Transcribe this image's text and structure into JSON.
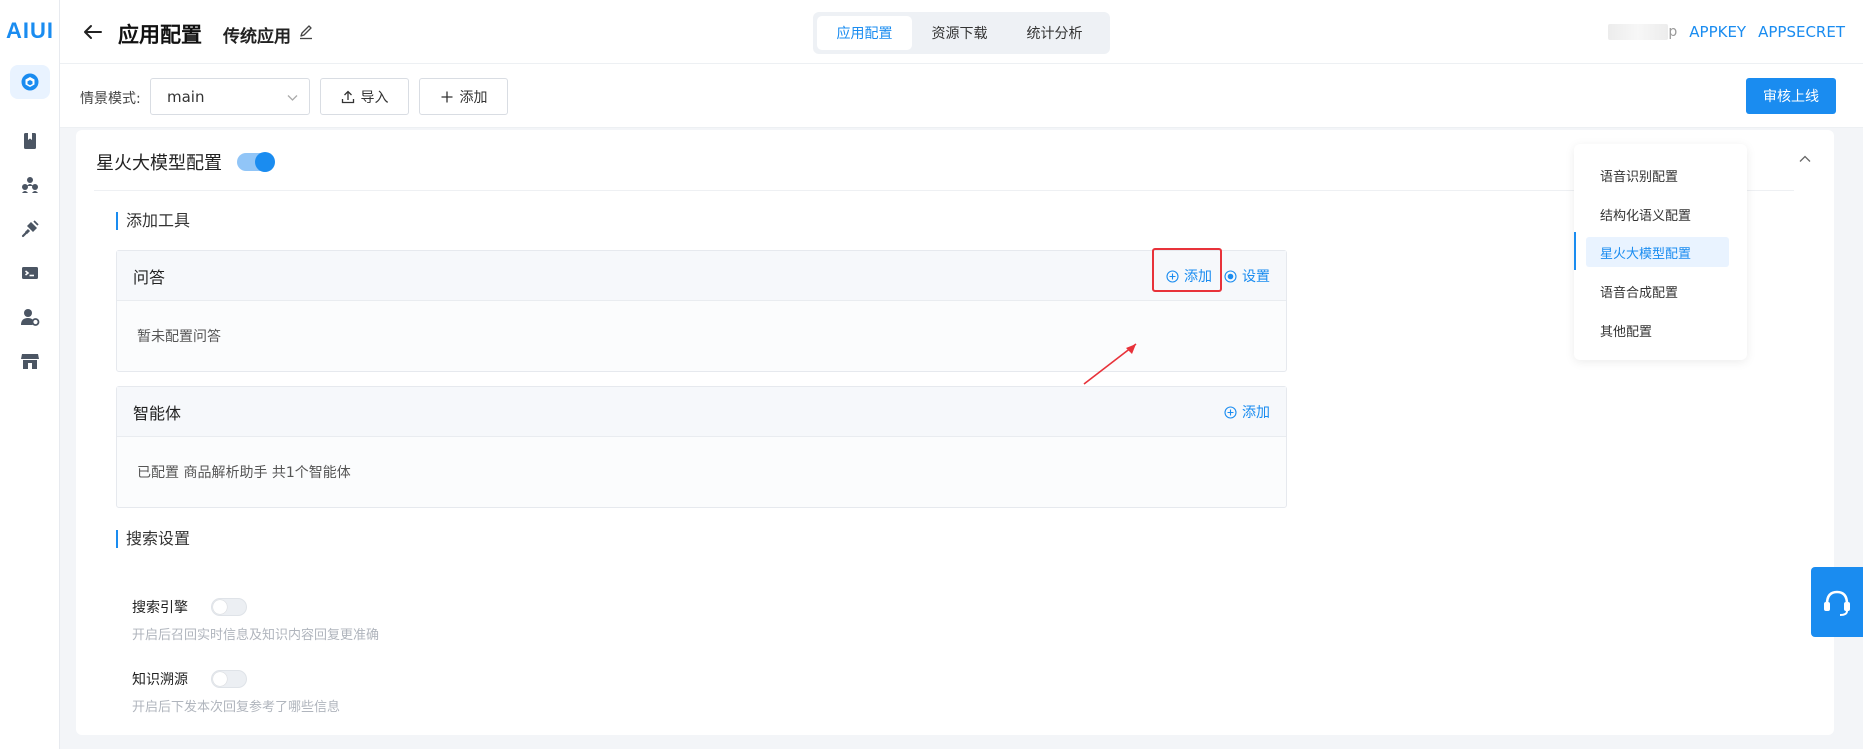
{
  "brand": {
    "logo_text": "AIUI"
  },
  "rail": {
    "items": [
      {
        "name": "app-cube-icon"
      },
      {
        "name": "book-icon"
      },
      {
        "name": "team-icon"
      },
      {
        "name": "plugin-icon"
      },
      {
        "name": "terminal-icon"
      },
      {
        "name": "user-settings-icon"
      },
      {
        "name": "store-icon"
      }
    ]
  },
  "header": {
    "title": "应用配置",
    "app_name": "传统应用",
    "tabs": [
      {
        "label": "应用配置",
        "active": true
      },
      {
        "label": "资源下载",
        "active": false
      },
      {
        "label": "统计分析",
        "active": false
      }
    ],
    "right_suffix": "p",
    "appkey_label": "APPKEY",
    "appsecret_label": "APPSECRET"
  },
  "toolbar": {
    "mode_label": "情景模式:",
    "mode_value": "main",
    "import_label": "导入",
    "add_label": "添加",
    "review_label": "审核上线"
  },
  "spark": {
    "title": "星火大模型配置",
    "enabled": true,
    "add_tools_heading": "添加工具",
    "qa": {
      "title": "问答",
      "add_label": "添加",
      "settings_label": "设置",
      "body": "暂未配置问答"
    },
    "agent": {
      "title": "智能体",
      "add_label": "添加",
      "body": "已配置 商品解析助手 共1个智能体"
    },
    "search_heading": "搜索设置",
    "search_engine": {
      "label": "搜索引擎",
      "enabled": false,
      "desc": "开启后召回实时信息及知识内容回复更准确"
    },
    "knowledge_trace": {
      "label": "知识溯源",
      "enabled": false,
      "desc": "开启后下发本次回复参考了哪些信息"
    }
  },
  "anchor_nav": {
    "items": [
      {
        "label": "语音识别配置",
        "active": false
      },
      {
        "label": "结构化语义配置",
        "active": false
      },
      {
        "label": "星火大模型配置",
        "active": true
      },
      {
        "label": "语音合成配置",
        "active": false
      },
      {
        "label": "其他配置",
        "active": false
      }
    ]
  },
  "colors": {
    "accent": "#1a8cf0",
    "highlight": "#e8323a"
  }
}
